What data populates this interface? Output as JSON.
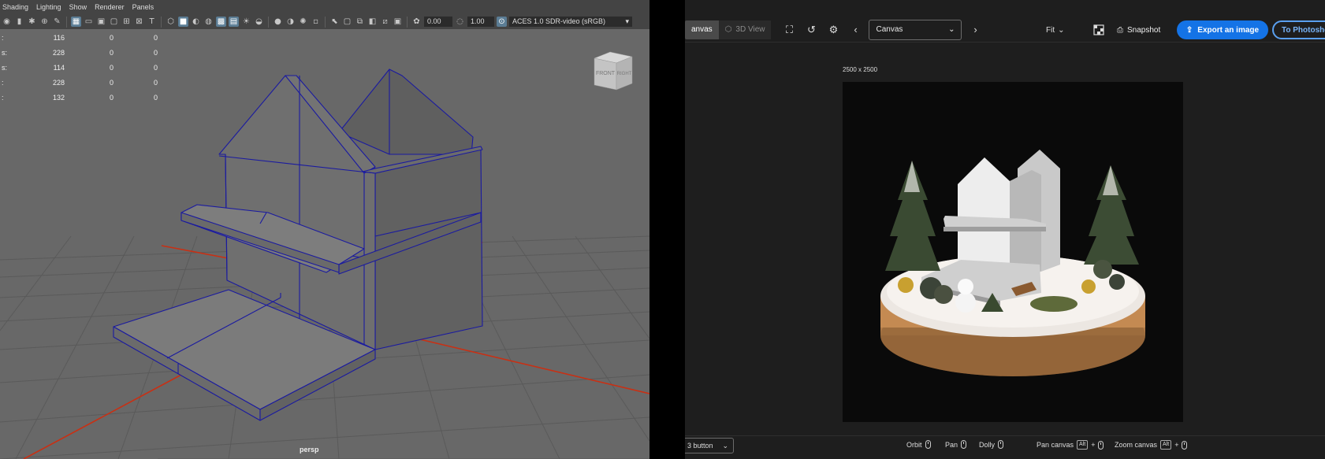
{
  "maya": {
    "menu": [
      "Shading",
      "Lighting",
      "Show",
      "Renderer",
      "Panels"
    ],
    "toolbar": {
      "field1": "0.00",
      "field2": "1.00",
      "colorspace": "ACES 1.0 SDR-video (sRGB)"
    },
    "hud": [
      {
        "label": ":",
        "a": "116",
        "b": "0",
        "c": "0"
      },
      {
        "label": "s:",
        "a": "228",
        "b": "0",
        "c": "0"
      },
      {
        "label": "s:",
        "a": "114",
        "b": "0",
        "c": "0"
      },
      {
        "label": ":",
        "a": "228",
        "b": "0",
        "c": "0"
      },
      {
        "label": ":",
        "a": "132",
        "b": "0",
        "c": "0"
      }
    ],
    "viewcube": {
      "front": "FRONT",
      "right": "RIGHT"
    },
    "camera_label": "persp"
  },
  "adobe": {
    "tabs": {
      "canvas": "anvas",
      "view3d": "3D View"
    },
    "canvas_select": "Canvas",
    "fit_label": "Fit",
    "snapshot_label": "Snapshot",
    "export_label": "Export an image",
    "photoshop_label": "To Photoshop",
    "doc_size": "2500 x 2500",
    "footer": {
      "mouse_select": "3 button",
      "orbit": "Orbit",
      "pan": "Pan",
      "dolly": "Dolly",
      "pan_canvas": "Pan canvas",
      "zoom_canvas": "Zoom canvas",
      "alt_key": "Alt"
    }
  },
  "colors": {
    "maya_bg": "#686868",
    "wire": "#1a1aa0",
    "axis_red": "#c83014",
    "adobe_blue": "#1473e6"
  }
}
